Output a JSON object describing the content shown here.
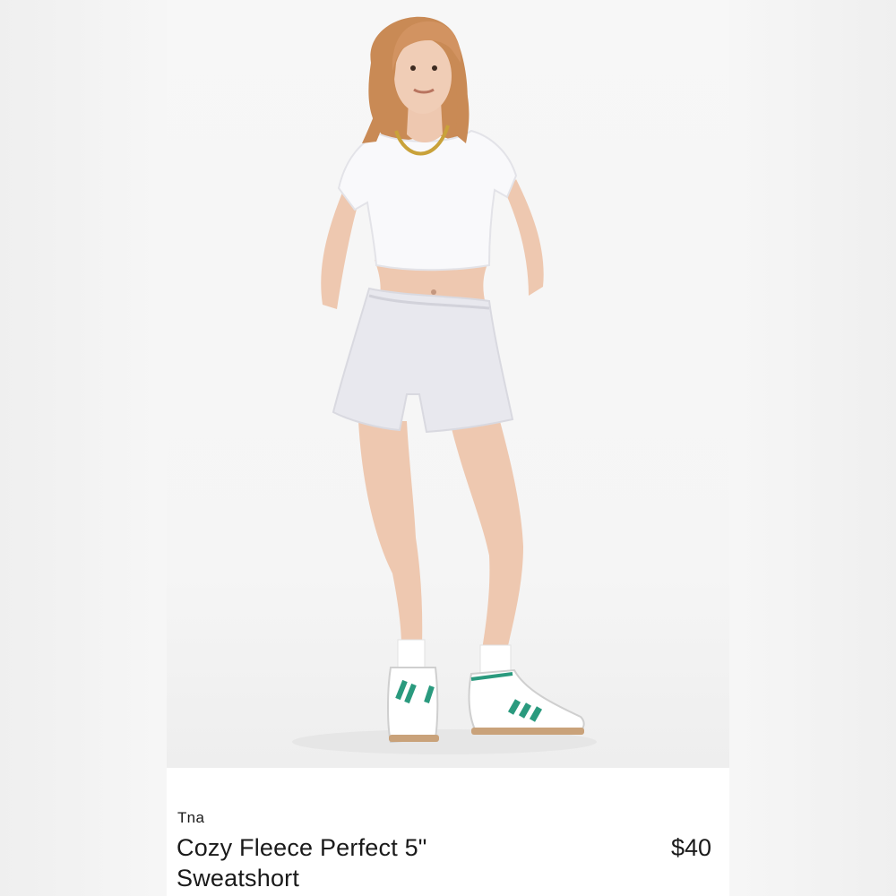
{
  "listing": {
    "brand": "Tna",
    "title": "Cozy Fleece Perfect 5\" Sweatshort",
    "price": "$40"
  },
  "colors": {
    "background": "#f6f6f6",
    "card": "#ffffff",
    "text": "#1a1a1a",
    "sneaker_stripes": "#2a9a7e"
  }
}
